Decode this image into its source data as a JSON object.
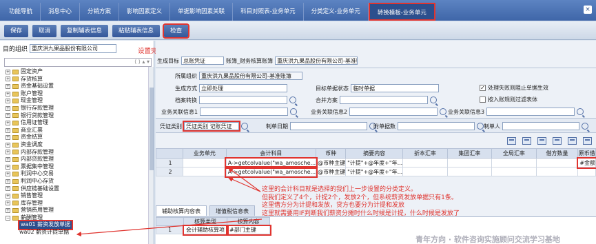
{
  "tabs": [
    {
      "label": "功能导航"
    },
    {
      "label": "消息中心"
    },
    {
      "label": "分销方案"
    },
    {
      "label": "影响因素定义"
    },
    {
      "label": "单据影响因素关联"
    },
    {
      "label": "科目对照表-业务单元"
    },
    {
      "label": "分类定义-业务单元"
    },
    {
      "label": "转换模板-业务单元"
    }
  ],
  "tab_close": "×",
  "toolbar": {
    "save": "保存",
    "cancel": "取消",
    "copy": "复制辅表信息",
    "paste": "粘贴辅表信息",
    "check": "检查"
  },
  "left": {
    "org_label": "目的组织",
    "org_value": "重庆洪九果品股份有限公司",
    "note": "设置完了点击检查下，就可提示报错。",
    "search_arrows": "⟨ ⟩ ▴ ▾",
    "tree": [
      {
        "label": "固定资产",
        "exp": "+"
      },
      {
        "label": "存货核算",
        "exp": "+"
      },
      {
        "label": "资金基础设置",
        "exp": "+"
      },
      {
        "label": "账户管理",
        "exp": "+"
      },
      {
        "label": "现金管理",
        "exp": "+"
      },
      {
        "label": "银行存款管理",
        "exp": "+"
      },
      {
        "label": "银行贷款管理",
        "exp": "+"
      },
      {
        "label": "信用证管理",
        "exp": "+"
      },
      {
        "label": "商业汇票",
        "exp": "+"
      },
      {
        "label": "资金结算",
        "exp": "+"
      },
      {
        "label": "资金调度",
        "exp": "+"
      },
      {
        "label": "内部存款管理",
        "exp": "+"
      },
      {
        "label": "内部贷款管理",
        "exp": "+"
      },
      {
        "label": "票据集中管理",
        "exp": "+"
      },
      {
        "label": "利润中心交易",
        "exp": "+"
      },
      {
        "label": "利润中心存货",
        "exp": "+"
      },
      {
        "label": "供应链基础设置",
        "exp": "+"
      },
      {
        "label": "销售管理",
        "exp": "+"
      },
      {
        "label": "库存管理",
        "exp": "+"
      },
      {
        "label": "营销费用管理",
        "exp": "+"
      },
      {
        "label": "薪酬管理",
        "exp": "−"
      }
    ],
    "children": [
      {
        "label": "wa01 薪资发放单据"
      },
      {
        "label": "wa02 薪资计提单据"
      }
    ]
  },
  "form": {
    "target_label": "生成目标",
    "target_value": "总账凭证",
    "account_label": "账簿_财务核算账簿",
    "account_value": "重庆洪九果品股份有限公司-基准账簿",
    "org_label": "所属组织",
    "org_value": "重庆洪九果品股份有限公司-基准账簿",
    "gen_mode_label": "生成方式",
    "gen_mode_value": "立即处理",
    "target_state_label": "目标单据状态",
    "target_state_value": "临时单据",
    "cb1_label": "处理失败则阻止单据生效",
    "cb1_checked": "✓",
    "cb2_label": "按入账规则过滤表体",
    "archive_label": "档案转换",
    "merge_label": "合并方案",
    "biz1_label": "业务关联信息1",
    "biz2_label": "业务关联信息2",
    "biz3_label": "业务关联信息3"
  },
  "voucher": {
    "type_label": "凭证类别",
    "type_value": "凭证类别 记账凭证",
    "date_label": "制单日期",
    "attach_label": "附单据数",
    "maker_label": "制单人"
  },
  "grid": {
    "headers": [
      "",
      "业务单元",
      "会计科目",
      "币种",
      "摘要内容",
      "折本汇率",
      "集团汇率",
      "全局汇率",
      "借方数量",
      "原币借"
    ],
    "rows": [
      [
        "1",
        "",
        "A->getcolvalue(\"wa_amosche...",
        "@币种主键",
        "\"计提\"+@年度+\"年...",
        "",
        "",
        "",
        "",
        "#金额"
      ],
      [
        "2",
        "",
        "A->getcolvalue(\"wa_amosche...",
        "@币种主键",
        "\"计提\"+@年度+\"年...",
        "",
        "",
        "",
        "",
        ""
      ]
    ]
  },
  "annotation": [
    "这里的会计科目就是选择的我们上一步设置的分类定义。",
    "但我们定义了4个，计提2个，发放2个，但系统薪资发放单据只有1条。",
    "这里借方分为计提和发放，贷方也要分为计提和发放",
    "这里就需要用IF判断我们薪资分摊时什么时候是计提，什么时候是发放了"
  ],
  "bottom_tabs": {
    "aux": "辅助核算内容表",
    "vat": "增值税信息表"
  },
  "sub_grid": {
    "headers": [
      "",
      "核算类型",
      "核算内容"
    ],
    "row": [
      "1",
      "会计辅助核算项",
      "#部门主键"
    ]
  },
  "watermark": "青年方向 · 软件咨询实施顾问交流学习基地",
  "colors": {
    "accent": "#e0342f",
    "brand": "#3f66a8"
  }
}
